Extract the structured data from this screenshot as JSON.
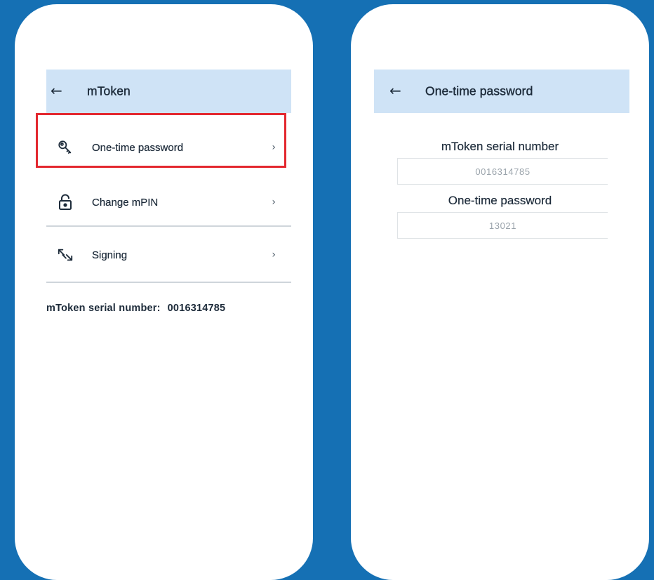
{
  "left_screen": {
    "header": {
      "title": "mToken",
      "back_icon": "arrow-left-icon"
    },
    "menu": [
      {
        "label": "One-time password",
        "icon": "key-icon",
        "highlighted": true
      },
      {
        "label": "Change mPIN",
        "icon": "unlock-icon"
      },
      {
        "label": "Signing",
        "icon": "sign-arrows-icon"
      }
    ],
    "serial": {
      "label": "mToken serial number:",
      "value": "0016314785"
    }
  },
  "right_screen": {
    "header": {
      "title": "One-time password",
      "back_icon": "arrow-left-icon"
    },
    "fields": [
      {
        "label": "mToken serial number",
        "value": "0016314785"
      },
      {
        "label": "One-time password",
        "value": "13021"
      }
    ]
  },
  "colors": {
    "background": "#1570b4",
    "appbar": "#cfe3f6",
    "highlight": "#e3282f",
    "text": "#1d2b3a"
  }
}
